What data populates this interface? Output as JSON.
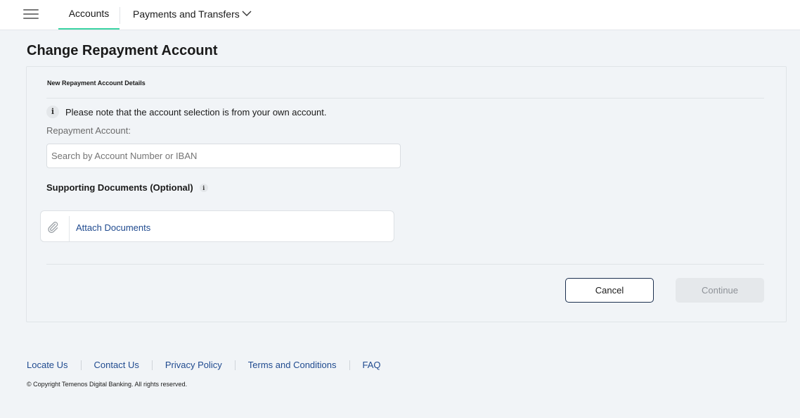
{
  "nav": {
    "tabs": [
      {
        "label": "Accounts",
        "active": true
      },
      {
        "label": "Payments and Transfers",
        "active": false
      }
    ],
    "accent_color": "#3ad3a3"
  },
  "page": {
    "title": "Change Repayment Account"
  },
  "form": {
    "section_title": "New Repayment Account Details",
    "info_text": "Please note that the account selection is from your own account.",
    "repayment_label": "Repayment Account:",
    "repayment_value": "",
    "repayment_placeholder": "Search by Account Number or IBAN",
    "docs_label": "Supporting Documents (Optional)",
    "attach_label": "Attach Documents",
    "cancel_label": "Cancel",
    "continue_label": "Continue"
  },
  "footer": {
    "links": [
      "Locate Us",
      "Contact Us",
      "Privacy Policy",
      "Terms and Conditions",
      "FAQ"
    ],
    "copyright": "© Copyright Temenos Digital Banking. All rights reserved."
  },
  "colors": {
    "link": "#1f4a8f",
    "primary_border": "#1b2f4f",
    "background": "#f1f4f7"
  },
  "icons": {
    "menu": "hamburger-menu-icon",
    "dropdown": "chevron-down-icon",
    "info": "info-icon",
    "attach": "paperclip-icon"
  }
}
